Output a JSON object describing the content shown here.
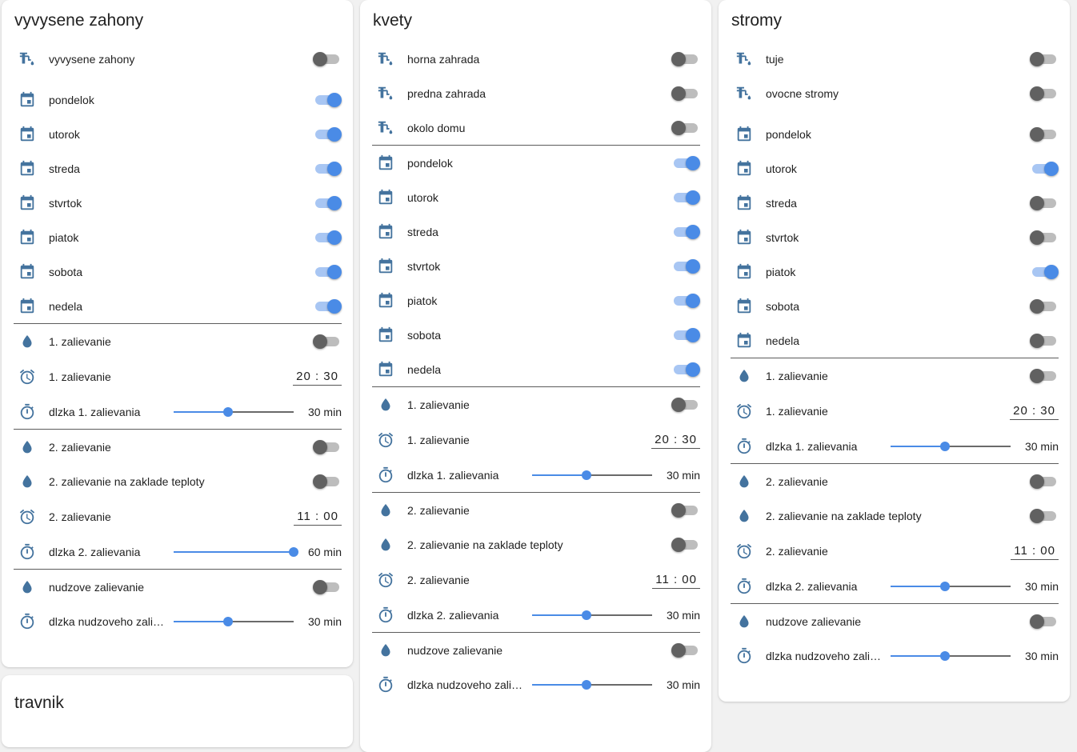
{
  "cards": {
    "vyvysene": {
      "title": "vyvysene zahony",
      "valves": [
        {
          "label": "vyvysene zahony",
          "on": false
        }
      ],
      "days": [
        {
          "label": "pondelok",
          "on": true
        },
        {
          "label": "utorok",
          "on": true
        },
        {
          "label": "streda",
          "on": true
        },
        {
          "label": "stvrtok",
          "on": true
        },
        {
          "label": "piatok",
          "on": true
        },
        {
          "label": "sobota",
          "on": true
        },
        {
          "label": "nedela",
          "on": true
        }
      ],
      "z1": {
        "toggle_label": "1. zalievanie",
        "toggle_on": false,
        "time_label": "1. zalievanie",
        "time": "20 : 30",
        "slider_label": "dlzka 1. zalievania",
        "slider_value": "30 min",
        "slider_fraction": 0.455
      },
      "z2": {
        "toggle_label": "2. zalievanie",
        "toggle_on": false,
        "temp_label": "2. zalievanie na zaklade teploty",
        "temp_on": false,
        "time_label": "2. zalievanie",
        "time": "11 : 00",
        "slider_label": "dlzka 2. zalievania",
        "slider_value": "60 min",
        "slider_fraction": 1.0
      },
      "emergency": {
        "toggle_label": "nudzove zalievanie",
        "toggle_on": false,
        "slider_label": "dlzka nudzoveho zalie…",
        "slider_value": "30 min",
        "slider_fraction": 0.455
      }
    },
    "travnik": {
      "title": "travnik"
    },
    "kvety": {
      "title": "kvety",
      "valves": [
        {
          "label": "horna zahrada",
          "on": false
        },
        {
          "label": "predna zahrada",
          "on": false
        },
        {
          "label": "okolo domu",
          "on": false
        }
      ],
      "days": [
        {
          "label": "pondelok",
          "on": true
        },
        {
          "label": "utorok",
          "on": true
        },
        {
          "label": "streda",
          "on": true
        },
        {
          "label": "stvrtok",
          "on": true
        },
        {
          "label": "piatok",
          "on": true
        },
        {
          "label": "sobota",
          "on": true
        },
        {
          "label": "nedela",
          "on": true
        }
      ],
      "z1": {
        "toggle_label": "1. zalievanie",
        "toggle_on": false,
        "time_label": "1. zalievanie",
        "time": "20 : 30",
        "slider_label": "dlzka 1. zalievania",
        "slider_value": "30 min",
        "slider_fraction": 0.455
      },
      "z2": {
        "toggle_label": "2. zalievanie",
        "toggle_on": false,
        "temp_label": "2. zalievanie na zaklade teploty",
        "temp_on": false,
        "time_label": "2. zalievanie",
        "time": "11 : 00",
        "slider_label": "dlzka 2. zalievania",
        "slider_value": "30 min",
        "slider_fraction": 0.455
      },
      "emergency": {
        "toggle_label": "nudzove zalievanie",
        "toggle_on": false,
        "slider_label": "dlzka nudzoveho zalie…",
        "slider_value": "30 min",
        "slider_fraction": 0.455
      }
    },
    "stromy": {
      "title": "stromy",
      "valves": [
        {
          "label": "tuje",
          "on": false
        },
        {
          "label": "ovocne stromy",
          "on": false
        }
      ],
      "days": [
        {
          "label": "pondelok",
          "on": false
        },
        {
          "label": "utorok",
          "on": true
        },
        {
          "label": "streda",
          "on": false
        },
        {
          "label": "stvrtok",
          "on": false
        },
        {
          "label": "piatok",
          "on": true
        },
        {
          "label": "sobota",
          "on": false
        },
        {
          "label": "nedela",
          "on": false
        }
      ],
      "z1": {
        "toggle_label": "1. zalievanie",
        "toggle_on": false,
        "time_label": "1. zalievanie",
        "time": "20 : 30",
        "slider_label": "dlzka 1. zalievania",
        "slider_value": "30 min",
        "slider_fraction": 0.455
      },
      "z2": {
        "toggle_label": "2. zalievanie",
        "toggle_on": false,
        "temp_label": "2. zalievanie na zaklade teploty",
        "temp_on": false,
        "time_label": "2. zalievanie",
        "time": "11 : 00",
        "slider_label": "dlzka 2. zalievania",
        "slider_value": "30 min",
        "slider_fraction": 0.455
      },
      "emergency": {
        "toggle_label": "nudzove zalievanie",
        "toggle_on": false,
        "slider_label": "dlzka nudzoveho zalie…",
        "slider_value": "30 min",
        "slider_fraction": 0.455
      }
    }
  },
  "icons": {
    "valve": "water-pump-icon",
    "day": "calendar-icon",
    "drop": "water-drop-icon",
    "alarm": "alarm-clock-icon",
    "timer": "timer-icon"
  },
  "colors": {
    "accent": "#4a8be6",
    "accent_track": "#a8c6f3",
    "off_knob": "#616161",
    "off_track": "#bdbdbd",
    "icon": "#44739e"
  }
}
